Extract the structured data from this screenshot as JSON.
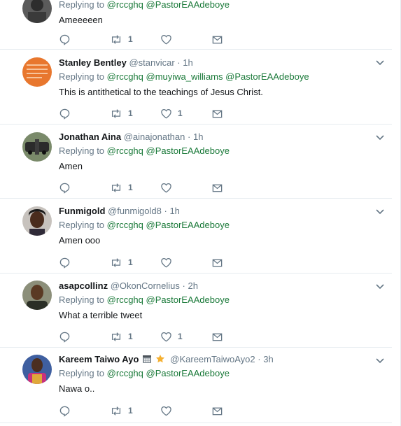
{
  "tweets": [
    {
      "name": "",
      "handle": "",
      "time": "",
      "replying_label": "Replying to",
      "mentions": [
        "@rccghq",
        "@PastorEAAdeboye"
      ],
      "text": "Ameeeeen",
      "retweets": "1",
      "likes": ""
    },
    {
      "name": "Stanley Bentley",
      "handle": "@stanvicar",
      "time": "1h",
      "replying_label": "Replying to",
      "mentions": [
        "@rccghq",
        "@muyiwa_williams",
        "@PastorEAAdeboye"
      ],
      "text": "This is antithetical to the teachings of Jesus Christ.",
      "retweets": "1",
      "likes": "1"
    },
    {
      "name": "Jonathan Aina",
      "handle": "@ainajonathan",
      "time": "1h",
      "replying_label": "Replying to",
      "mentions": [
        "@rccghq",
        "@PastorEAAdeboye"
      ],
      "text": "Amen",
      "retweets": "1",
      "likes": ""
    },
    {
      "name": "Funmigold",
      "handle": "@funmigold8",
      "time": "1h",
      "replying_label": "Replying to",
      "mentions": [
        "@rccghq",
        "@PastorEAAdeboye"
      ],
      "text": "Amen ooo",
      "retweets": "1",
      "likes": ""
    },
    {
      "name": "asapcollinz",
      "handle": "@OkonCornelius",
      "time": "2h",
      "replying_label": "Replying to",
      "mentions": [
        "@rccghq",
        "@PastorEAAdeboye"
      ],
      "text": "What a terrible tweet",
      "retweets": "1",
      "likes": "1"
    },
    {
      "name": "Kareem Taiwo Ayo",
      "handle": "@KareemTaiwoAyo2",
      "time": "3h",
      "replying_label": "Replying to",
      "mentions": [
        "@rccghq",
        "@PastorEAAdeboye"
      ],
      "text": "Nawa o..",
      "retweets": "1",
      "likes": ""
    }
  ],
  "icons": {
    "reply": "reply-icon",
    "retweet": "retweet-icon",
    "like": "heart-icon",
    "dm": "envelope-icon",
    "more": "chevron-down-icon",
    "name_badges": [
      "calendar-emoji-icon",
      "star-emoji-icon"
    ]
  },
  "colors": {
    "name": "#14171a",
    "meta": "#657786",
    "mention": "#1b7a3a",
    "divider": "#e6ecf0",
    "icon": "#657786"
  }
}
